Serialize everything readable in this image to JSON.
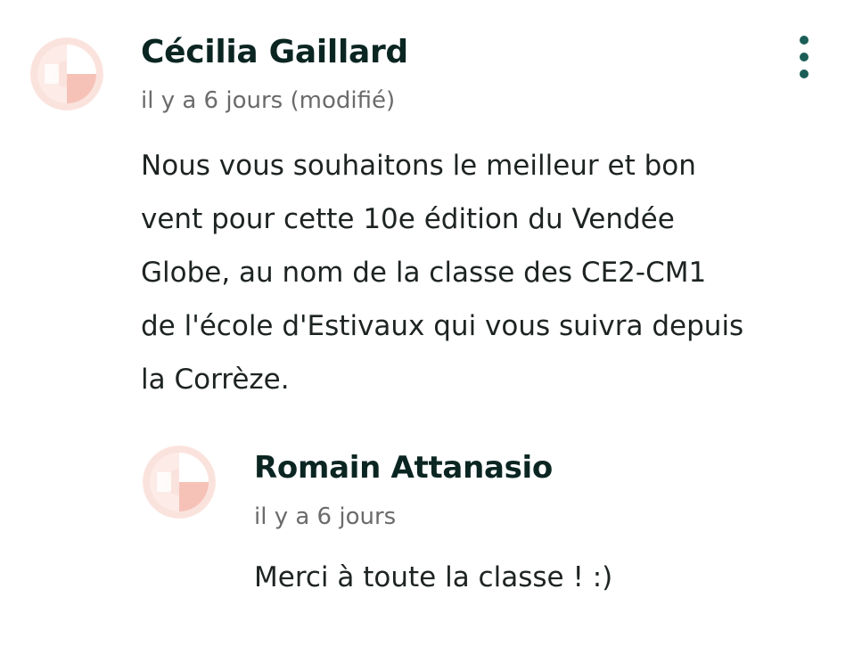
{
  "comments": [
    {
      "author": "Cécilia Gaillard",
      "timestamp": "il y a 6 jours (modifié)",
      "body_lines": [
        "Nous vous souhaitons le meilleur et bon",
        "vent pour cette 10e édition du Vendée",
        "Globe, au nom de la classe des CE2-CM1",
        "de l'école d'Estivaux qui vous suivra depuis",
        "la Corrèze."
      ],
      "avatar_icon": "letter-e-avatar-icon",
      "menu_icon": "more-vertical-icon"
    },
    {
      "author": "Romain Attanasio",
      "timestamp": "il y a 6 jours",
      "body": "Merci à toute la classe ! :)",
      "avatar_icon": "letter-e-avatar-icon"
    }
  ],
  "colors": {
    "author": "#0b2622",
    "meta": "#6b6b6b",
    "body": "#1d2422",
    "menu_dots": "#1b5e57",
    "avatar_light": "#fbe3dd",
    "avatar_mid": "#f6c2b8",
    "avatar_white": "#ffffff"
  }
}
